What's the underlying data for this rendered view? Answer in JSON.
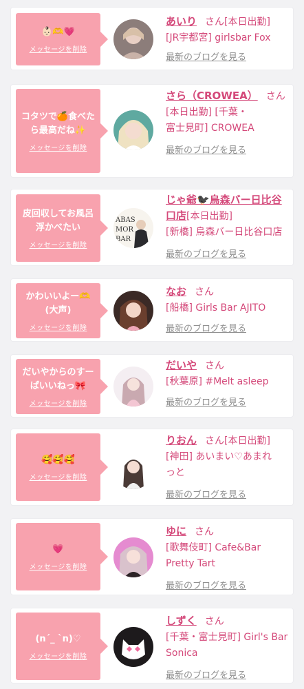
{
  "colors": {
    "accent": "#d4497a",
    "bubble": "#f8a2ae",
    "muted": "#8f8f8f",
    "background": "#f2f2f4"
  },
  "cards": [
    {
      "message": "👶🏻🫶💗",
      "delete_label": "メッセージを削除",
      "name": "あいり",
      "honorific": "さん",
      "badge": "[本日出勤]",
      "shop": "[JR宇都宮] girlsbar Fox",
      "blog_link": "最新のブログを見る"
    },
    {
      "message": "コタツで🍊食べたら最高だね✨",
      "delete_label": "メッセージを削除",
      "name": "さら（CROWEA）",
      "honorific": "さん",
      "badge": "",
      "shop": "[本日出勤] [千葉・富士見町] CROWEA",
      "blog_link": "最新のブログを見る"
    },
    {
      "message": "皮回収してお風呂浮かべたい",
      "delete_label": "メッセージを削除",
      "name": "じゃ爺🐦‍⬛烏森バー日比谷口店",
      "honorific": "",
      "badge": "[本日出勤]",
      "shop": "[新橋] 烏森バー日比谷口店",
      "blog_link": "最新のブログを見る"
    },
    {
      "message": "かわいいよー🫶 (大声)",
      "delete_label": "メッセージを削除",
      "name": "なお",
      "honorific": "さん",
      "badge": "",
      "shop": "[船橋] Girls Bar AJITO",
      "blog_link": "最新のブログを見る"
    },
    {
      "message": "だいやからのすーぱいいねっ🎀",
      "delete_label": "メッセージを削除",
      "name": "だいや",
      "honorific": "さん",
      "badge": "",
      "shop": "[秋葉原] #Melt asleep",
      "blog_link": "最新のブログを見る"
    },
    {
      "message": "🥰🥰🥰",
      "delete_label": "メッセージを削除",
      "name": "りおん",
      "honorific": "さん",
      "badge": "[本日出勤]",
      "shop": "[神田] あいまい♡あまれっと",
      "blog_link": "最新のブログを見る"
    },
    {
      "message": "💗",
      "delete_label": "メッセージを削除",
      "name": "ゆに",
      "honorific": "さん",
      "badge": "",
      "shop": "[歌舞伎町] Cafe&Bar Pretty Tart",
      "blog_link": "最新のブログを見る"
    },
    {
      "message": "(n´_ ˋn)♡",
      "delete_label": "メッセージを削除",
      "name": "しずく",
      "honorific": "さん",
      "badge": "",
      "shop": "[千葉・富士見町] Girl's Bar Sonica",
      "blog_link": "最新のブログを見る"
    }
  ]
}
